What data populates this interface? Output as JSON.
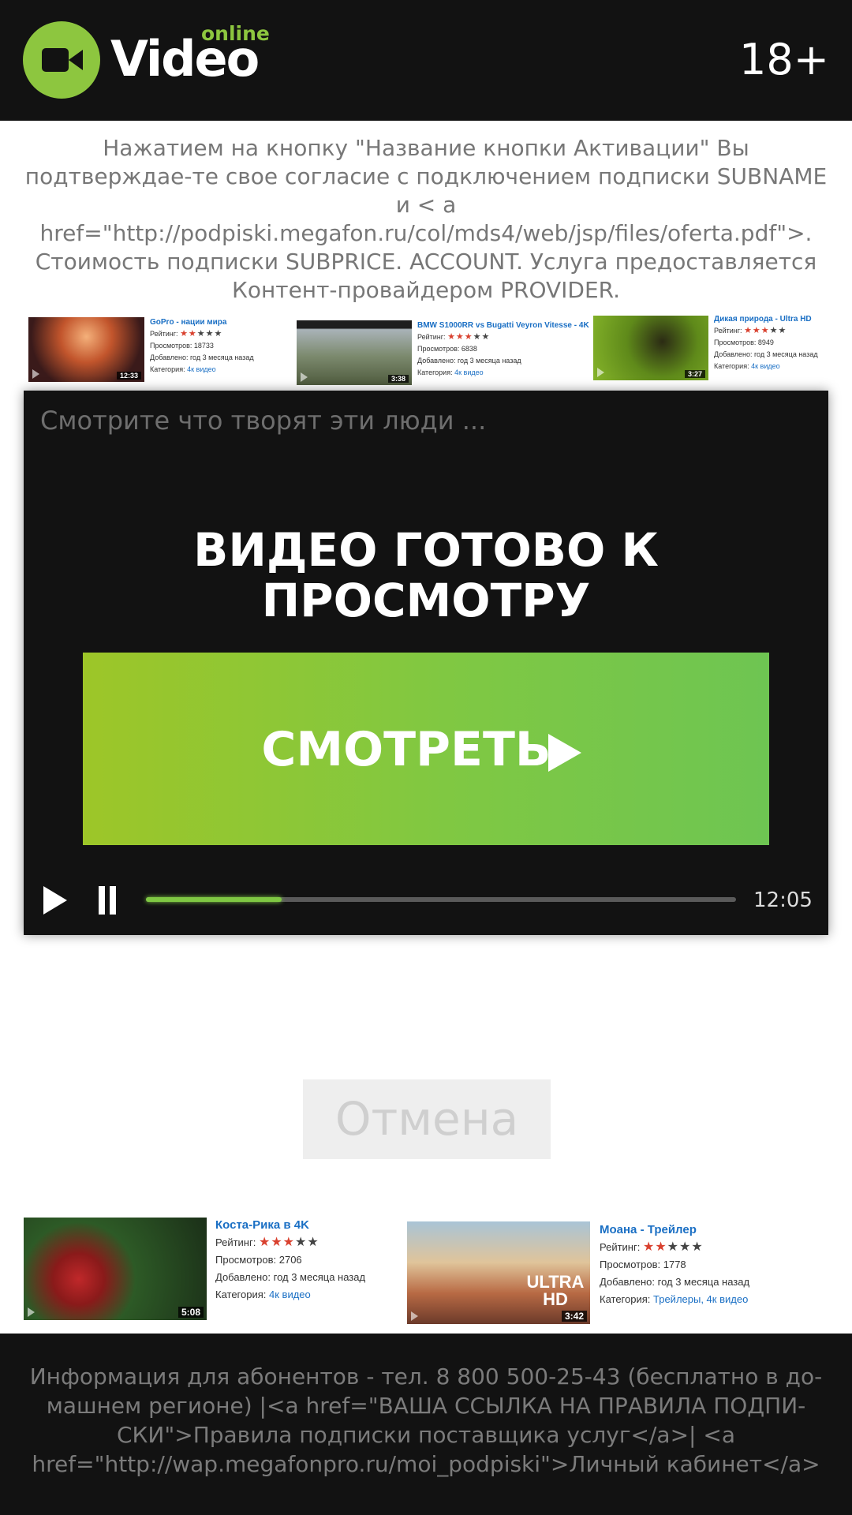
{
  "header": {
    "logo_word": "Video",
    "logo_tag": "online",
    "age_rating": "18+",
    "brand_color": "#8dc63f"
  },
  "offer_text": "Нажатием на кнопку \"Название кнопки Активации\" Вы подтверждае-те свое согласие с подключением подписки SUBNAME и < a href=\"http://podpiski.megafon.ru/col/mds4/web/jsp/files/oferta.pdf\">. Стоимость подписки SUBPRICE. ACCOUNT. Услуга предоставляется Контент-провайдером PROVIDER.",
  "videos_top": [
    {
      "title": "GoPro - нации мира",
      "rating_label": "Рейтинг:",
      "rating": 2,
      "views": "Просмотров: 18733",
      "added": "Добавлено: год 3 месяца назад",
      "category_label": "Категория:",
      "category": "4к видео",
      "duration": "12:33"
    },
    {
      "title": "BMW S1000RR vs Bugatti Veyron Vitesse - 4K",
      "rating_label": "Рейтинг:",
      "rating": 3,
      "views": "Просмотров: 6838",
      "added": "Добавлено: год 3 месяца назад",
      "category_label": "Категория:",
      "category": "4к видео",
      "duration": "3:38"
    },
    {
      "title": "Дикая природа - Ultra HD",
      "rating_label": "Рейтинг:",
      "rating": 3,
      "views": "Просмотров: 8949",
      "added": "Добавлено: год 3 месяца назад",
      "category_label": "Категория:",
      "category": "4к видео",
      "duration": "3:27"
    }
  ],
  "player": {
    "caption": "Смотрите что творят эти люди ...",
    "ready_text": "ВИДЕО ГОТОВО К ПРОСМОТРУ",
    "watch_label": "СМОТРЕТЬ",
    "progress": 0.23,
    "time": "12:05",
    "accent": "#7fc843"
  },
  "cancel_label": "Отмена",
  "videos_bottom": [
    {
      "title": "Коста-Рика в 4K",
      "rating_label": "Рейтинг:",
      "rating": 3,
      "views": "Просмотров: 2706",
      "added": "Добавлено: год 3 месяца назад",
      "category_label": "Категория:",
      "category": "4к видео",
      "duration": "5:08"
    },
    {
      "title": "Моана - Трейлер",
      "rating_label": "Рейтинг:",
      "rating": 2,
      "views": "Просмотров: 1778",
      "added": "Добавлено: год 3 месяца назад",
      "category_label": "Категория:",
      "category": "Трейлеры, 4к видео",
      "duration": "3:42",
      "badge": "ULTRA HD"
    }
  ],
  "footer_text": "Информация для абонентов - тел. 8 800 500-25-43 (бесплатно в до-машнем регионе) |<a href=\"ВАША ССЫЛКА НА ПРАВИЛА ПОДПИ-СКИ\">Правила подписки поставщика услуг</a>| <a href=\"http://wap.megafonpro.ru/moi_podpiski\">Личный кабинет</a>"
}
